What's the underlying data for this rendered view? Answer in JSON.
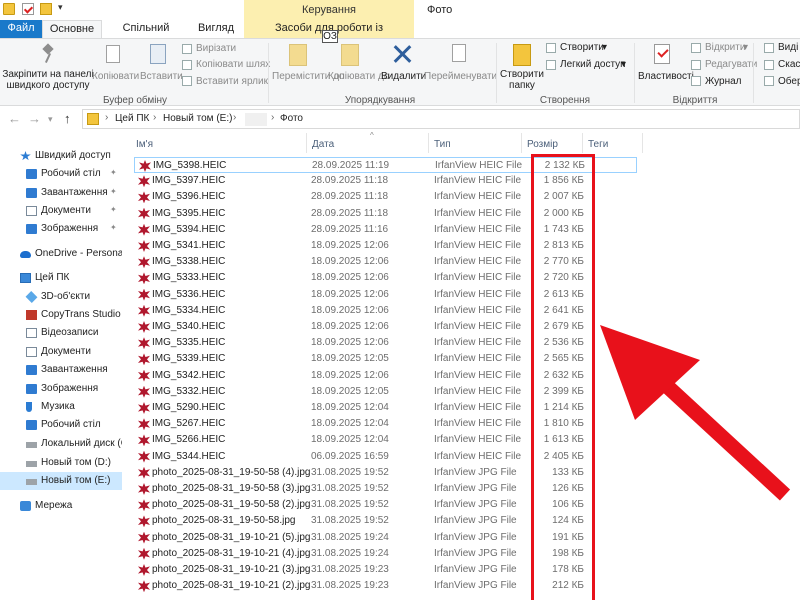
{
  "title_bar": {
    "context_tab_header": "Керування",
    "window_title": "Фото"
  },
  "tabs": {
    "file": "Файл",
    "home": "Основне",
    "share": "Спільний доступ",
    "view": "Вигляд",
    "picture_tools": "Засоби для роботи із зображеннями",
    "keytip": "ОЗ"
  },
  "ribbon": {
    "clipboard": {
      "pin_label": "Закріпити на панелі швидкого доступу",
      "copy_label": "Копіювати",
      "paste_label": "Вставити",
      "cut_label": "Вирізати",
      "copy_path_label": "Копіювати шлях",
      "paste_shortcut_label": "Вставити ярлик",
      "group_label": "Буфер обміну"
    },
    "organize": {
      "move_to_label": "Перемістити до",
      "copy_to_label": "Копіювати до",
      "delete_label": "Видалити",
      "rename_label": "Перейменувати",
      "group_label": "Упорядкування"
    },
    "new": {
      "new_folder_label": "Створити папку",
      "new_item_label": "Створити",
      "easy_access_label": "Легкий доступ",
      "group_label": "Створення"
    },
    "open": {
      "properties_label": "Властивості",
      "open_label": "Відкрити",
      "edit_label": "Редагувати",
      "history_label": "Журнал",
      "group_label": "Відкриття"
    },
    "select": {
      "select_all_label": "Виді",
      "select_none_label": "Скасу",
      "invert_label": "Обер"
    }
  },
  "address_bar": {
    "crumbs": [
      "Цей ПК",
      "Новый том (E:)",
      "Фото"
    ]
  },
  "nav_pane": {
    "items": [
      {
        "label": "Швидкий доступ",
        "icon": "star-icon",
        "pinned": false
      },
      {
        "label": "Робочий стіл",
        "icon": "desktop-icon",
        "pinned": true
      },
      {
        "label": "Завантаження",
        "icon": "download-icon",
        "pinned": true
      },
      {
        "label": "Документи",
        "icon": "documents-icon",
        "pinned": true
      },
      {
        "label": "Зображення",
        "icon": "pictures-icon",
        "pinned": true
      },
      {
        "label": "OneDrive - Personal",
        "icon": "cloud-icon",
        "pinned": false
      },
      {
        "label": "Цей ПК",
        "icon": "pc-icon",
        "pinned": false
      },
      {
        "label": "3D-об'єкти",
        "icon": "3d-objects-icon",
        "pinned": false
      },
      {
        "label": "CopyTrans Studio",
        "icon": "app-folder-icon",
        "pinned": false
      },
      {
        "label": "Відеозаписи",
        "icon": "videos-icon",
        "pinned": false
      },
      {
        "label": "Документи",
        "icon": "documents-icon",
        "pinned": false
      },
      {
        "label": "Завантаження",
        "icon": "download-icon",
        "pinned": false
      },
      {
        "label": "Зображення",
        "icon": "pictures-icon",
        "pinned": false
      },
      {
        "label": "Музика",
        "icon": "music-icon",
        "pinned": false
      },
      {
        "label": "Робочий стіл",
        "icon": "desktop-icon",
        "pinned": false
      },
      {
        "label": "Локальний диск (C",
        "icon": "drive-icon",
        "pinned": false
      },
      {
        "label": "Новый том (D:)",
        "icon": "drive-icon",
        "pinned": false
      },
      {
        "label": "Новый том (E:)",
        "icon": "drive-icon",
        "pinned": false,
        "selected": true
      },
      {
        "label": "Мережа",
        "icon": "network-icon",
        "pinned": false
      }
    ]
  },
  "file_list": {
    "columns": {
      "name": "Ім'я",
      "date": "Дата",
      "type": "Тип",
      "size": "Розмір",
      "tags": "Теги"
    },
    "rows": [
      {
        "name": "IMG_5398.HEIC",
        "date": "28.09.2025 11:19",
        "type": "IrfanView HEIC File",
        "size": "2 132 КБ"
      },
      {
        "name": "IMG_5397.HEIC",
        "date": "28.09.2025 11:18",
        "type": "IrfanView HEIC File",
        "size": "1 856 КБ"
      },
      {
        "name": "IMG_5396.HEIC",
        "date": "28.09.2025 11:18",
        "type": "IrfanView HEIC File",
        "size": "2 007 КБ"
      },
      {
        "name": "IMG_5395.HEIC",
        "date": "28.09.2025 11:18",
        "type": "IrfanView HEIC File",
        "size": "2 000 КБ"
      },
      {
        "name": "IMG_5394.HEIC",
        "date": "28.09.2025 11:16",
        "type": "IrfanView HEIC File",
        "size": "1 743 КБ"
      },
      {
        "name": "IMG_5341.HEIC",
        "date": "18.09.2025 12:06",
        "type": "IrfanView HEIC File",
        "size": "2 813 КБ"
      },
      {
        "name": "IMG_5338.HEIC",
        "date": "18.09.2025 12:06",
        "type": "IrfanView HEIC File",
        "size": "2 770 КБ"
      },
      {
        "name": "IMG_5333.HEIC",
        "date": "18.09.2025 12:06",
        "type": "IrfanView HEIC File",
        "size": "2 720 КБ"
      },
      {
        "name": "IMG_5336.HEIC",
        "date": "18.09.2025 12:06",
        "type": "IrfanView HEIC File",
        "size": "2 613 КБ"
      },
      {
        "name": "IMG_5334.HEIC",
        "date": "18.09.2025 12:06",
        "type": "IrfanView HEIC File",
        "size": "2 641 КБ"
      },
      {
        "name": "IMG_5340.HEIC",
        "date": "18.09.2025 12:06",
        "type": "IrfanView HEIC File",
        "size": "2 679 КБ"
      },
      {
        "name": "IMG_5335.HEIC",
        "date": "18.09.2025 12:06",
        "type": "IrfanView HEIC File",
        "size": "2 536 КБ"
      },
      {
        "name": "IMG_5339.HEIC",
        "date": "18.09.2025 12:05",
        "type": "IrfanView HEIC File",
        "size": "2 565 КБ"
      },
      {
        "name": "IMG_5342.HEIC",
        "date": "18.09.2025 12:06",
        "type": "IrfanView HEIC File",
        "size": "2 632 КБ"
      },
      {
        "name": "IMG_5332.HEIC",
        "date": "18.09.2025 12:05",
        "type": "IrfanView HEIC File",
        "size": "2 399 КБ"
      },
      {
        "name": "IMG_5290.HEIC",
        "date": "18.09.2025 12:04",
        "type": "IrfanView HEIC File",
        "size": "1 214 КБ"
      },
      {
        "name": "IMG_5267.HEIC",
        "date": "18.09.2025 12:04",
        "type": "IrfanView HEIC File",
        "size": "1 810 КБ"
      },
      {
        "name": "IMG_5266.HEIC",
        "date": "18.09.2025 12:04",
        "type": "IrfanView HEIC File",
        "size": "1 613 КБ"
      },
      {
        "name": "IMG_5344.HEIC",
        "date": "06.09.2025 16:59",
        "type": "IrfanView HEIC File",
        "size": "2 405 КБ"
      },
      {
        "name": "photo_2025-08-31_19-50-58 (4).jpg",
        "date": "31.08.2025 19:52",
        "type": "IrfanView JPG File",
        "size": "133 КБ"
      },
      {
        "name": "photo_2025-08-31_19-50-58 (3).jpg",
        "date": "31.08.2025 19:52",
        "type": "IrfanView JPG File",
        "size": "126 КБ"
      },
      {
        "name": "photo_2025-08-31_19-50-58 (2).jpg",
        "date": "31.08.2025 19:52",
        "type": "IrfanView JPG File",
        "size": "106 КБ"
      },
      {
        "name": "photo_2025-08-31_19-50-58.jpg",
        "date": "31.08.2025 19:52",
        "type": "IrfanView JPG File",
        "size": "124 КБ"
      },
      {
        "name": "photo_2025-08-31_19-10-21 (5).jpg",
        "date": "31.08.2025 19:24",
        "type": "IrfanView JPG File",
        "size": "191 КБ"
      },
      {
        "name": "photo_2025-08-31_19-10-21 (4).jpg",
        "date": "31.08.2025 19:24",
        "type": "IrfanView JPG File",
        "size": "198 КБ"
      },
      {
        "name": "photo_2025-08-31_19-10-21 (3).jpg",
        "date": "31.08.2025 19:23",
        "type": "IrfanView JPG File",
        "size": "178 КБ"
      },
      {
        "name": "photo_2025-08-31_19-10-21 (2).jpg",
        "date": "31.08.2025 19:23",
        "type": "IrfanView JPG File",
        "size": "212 КБ"
      }
    ]
  },
  "colors": {
    "file_tab": "#1979ca",
    "context_tab": "#fcefb0",
    "selection": "#cce8ff",
    "annotation_red": "#e8111b"
  }
}
